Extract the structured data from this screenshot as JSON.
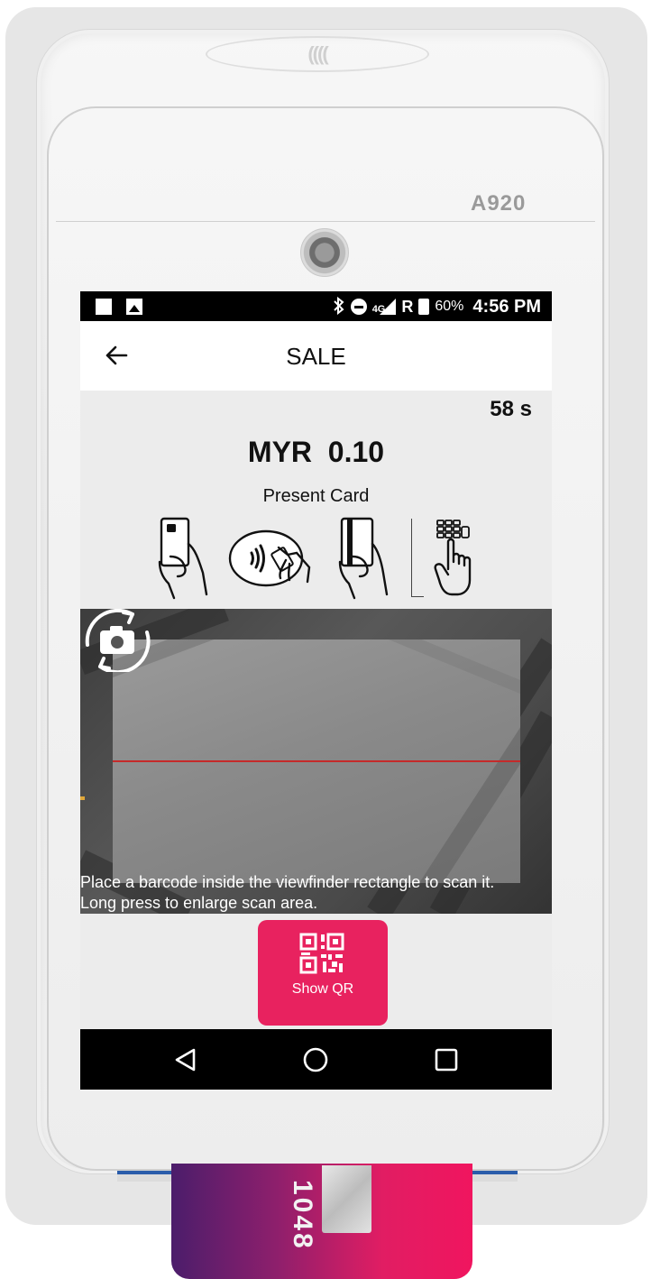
{
  "device": {
    "model": "A920",
    "contactless_logo": "((((",
    "card_number_partial": "1048"
  },
  "status_bar": {
    "battery_percent": "60%",
    "network": "4G",
    "roaming": "R",
    "time": "4:56 PM",
    "icons": [
      "notification-square-icon",
      "image-icon",
      "bluetooth-icon",
      "do-not-disturb-icon",
      "signal-icon",
      "battery-icon"
    ]
  },
  "app_bar": {
    "title": "SALE",
    "back_icon": "arrow-left-icon"
  },
  "payment": {
    "countdown": "58 s",
    "amount": "MYR  0.10",
    "prompt": "Present Card",
    "methods": [
      "insert-card-icon",
      "contactless-tap-icon",
      "swipe-card-icon",
      "manual-keypad-entry-icon"
    ]
  },
  "scanner": {
    "help_line_1": "Place a barcode inside the viewfinder rectangle to scan it.",
    "help_line_2": "Long press to enlarge scan area.",
    "laser_color": "#c52a2a",
    "flip_icon": "switch-camera-icon"
  },
  "show_qr": {
    "label": "Show QR",
    "color": "#e8225f"
  },
  "nav_bar": {
    "icons": [
      "back-triangle-icon",
      "home-circle-icon",
      "recents-square-icon"
    ]
  }
}
